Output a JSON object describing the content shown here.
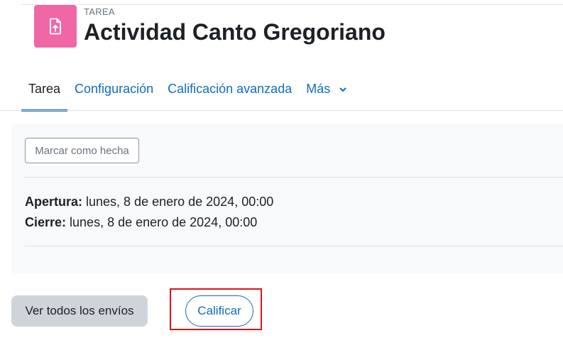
{
  "header": {
    "activity_type": "TAREA",
    "title": "Actividad Canto Gregoriano",
    "icon": "assignment-file-upload-icon",
    "icon_color": "#f067a6"
  },
  "tabs": [
    {
      "label": "Tarea",
      "active": true
    },
    {
      "label": "Configuración",
      "active": false
    },
    {
      "label": "Calificación avanzada",
      "active": false
    },
    {
      "label": "Más",
      "active": false,
      "icon": "chevron-down-icon"
    }
  ],
  "card": {
    "mark_done_label": "Marcar como hecha",
    "dates": [
      {
        "label": "Apertura:",
        "value": " lunes, 8 de enero de 2024, 00:00"
      },
      {
        "label": "Cierre:",
        "value": " lunes, 8 de enero de 2024, 00:00"
      }
    ]
  },
  "actions": {
    "view_all_label": "Ver todos los envíos",
    "grade_label": "Calificar"
  },
  "colors": {
    "link": "#0f6cbf",
    "highlight": "#e0121b"
  }
}
